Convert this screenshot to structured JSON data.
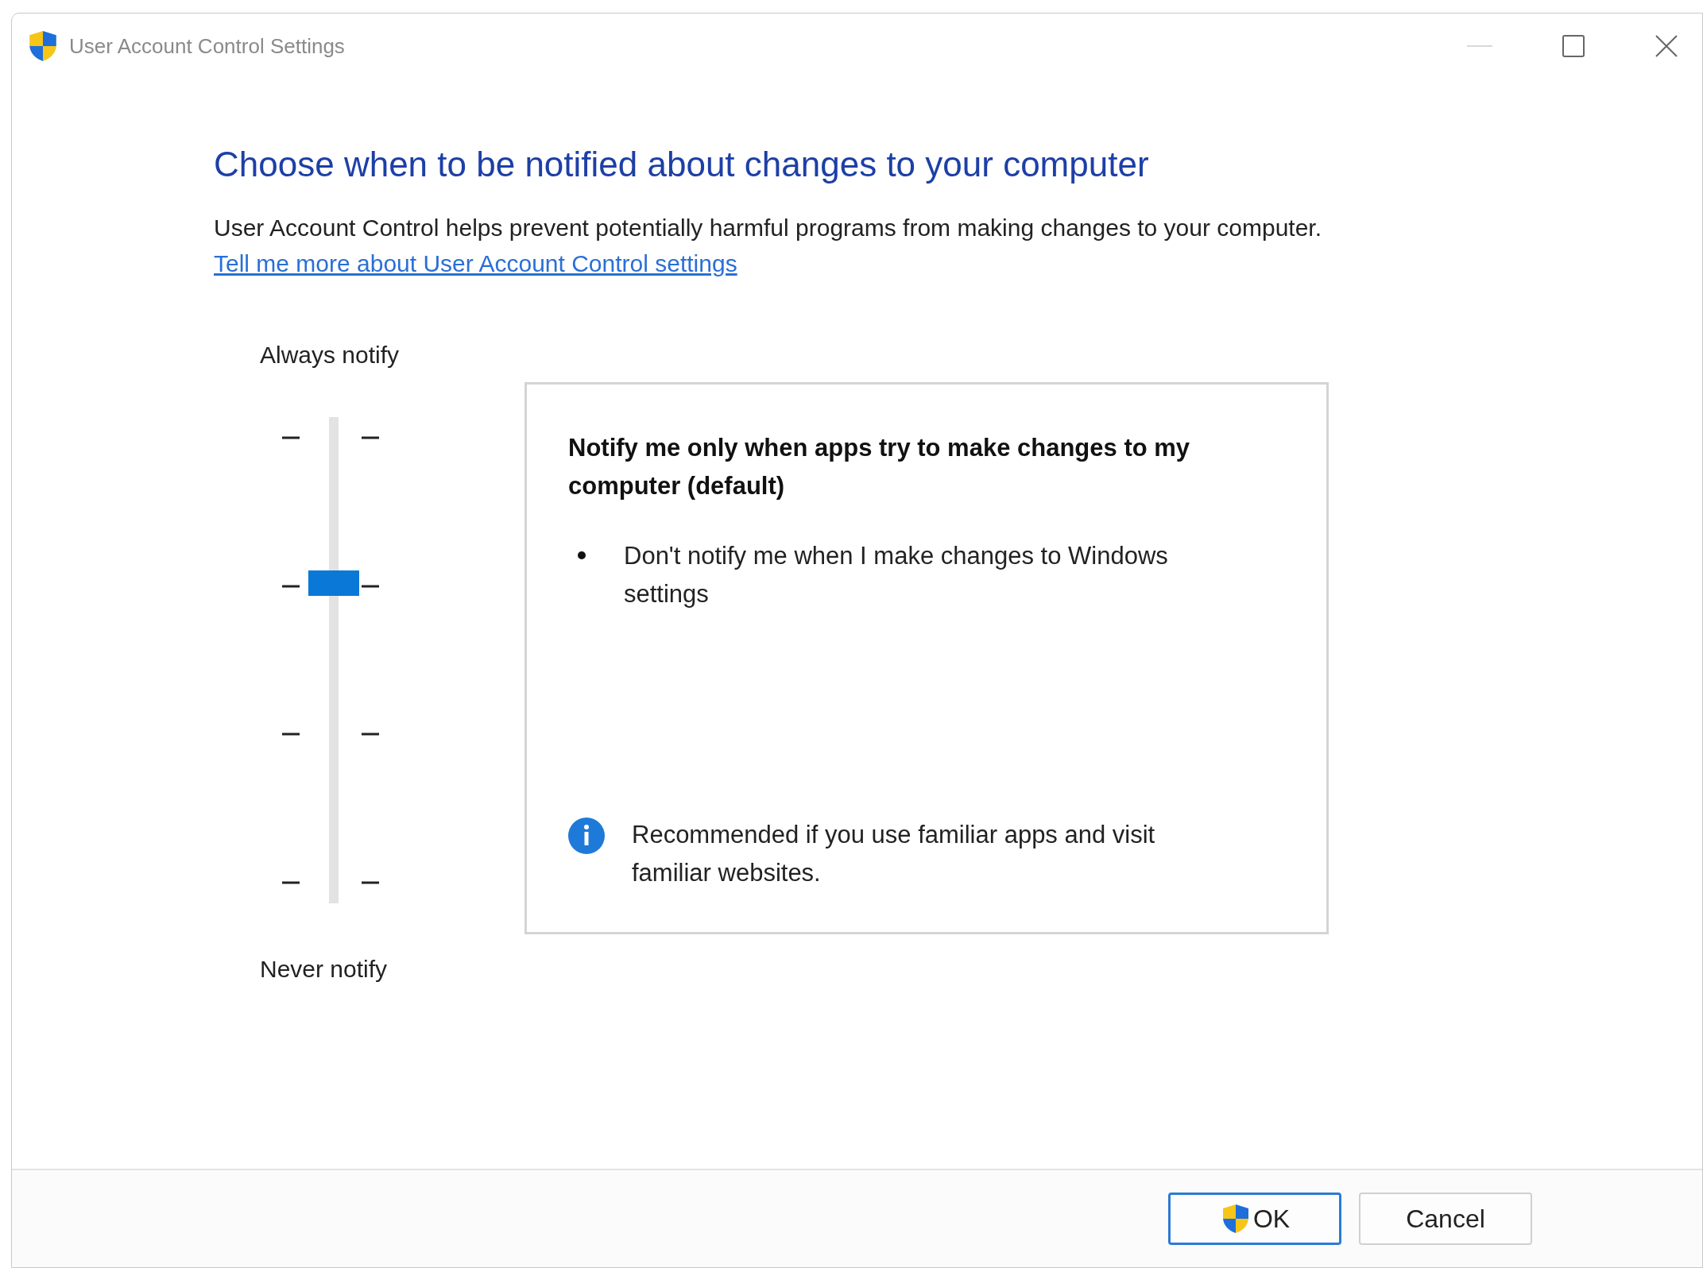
{
  "window": {
    "title": "User Account Control Settings"
  },
  "heading": "Choose when to be notified about changes to your computer",
  "description": "User Account Control helps prevent potentially harmful programs from making changes to your computer.",
  "link": "Tell me more about User Account Control settings",
  "slider": {
    "top_label": "Always notify",
    "bottom_label": "Never notify",
    "level": 0.667
  },
  "panel": {
    "title": "Notify me only when apps try to make changes to my computer (default)",
    "bullets": [
      "Don't notify me when I make changes to Windows settings"
    ],
    "note": "Recommended if you use familiar apps and visit familiar websites."
  },
  "buttons": [
    {
      "label": "OK",
      "kind": "shield",
      "default": true
    },
    {
      "label": "Cancel",
      "kind": "plain",
      "default": false
    }
  ]
}
